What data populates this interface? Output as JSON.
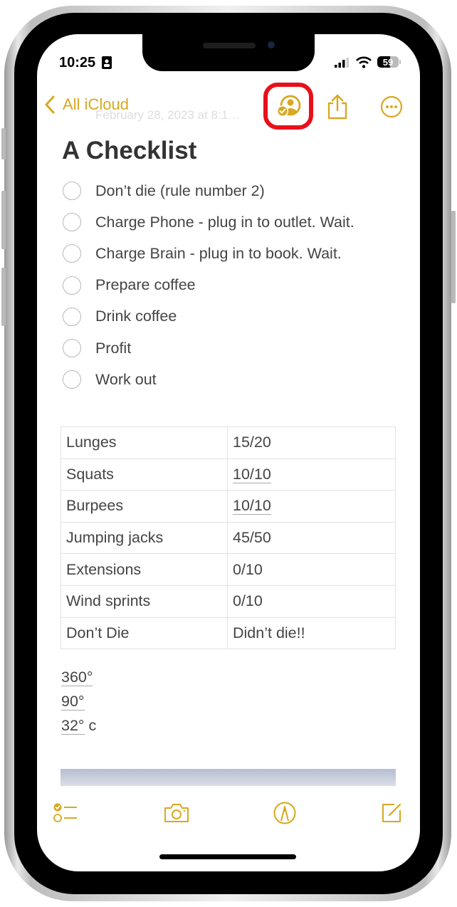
{
  "theme": {
    "accent": "#d8a820",
    "highlight": "#e8101a",
    "text": "#444444"
  },
  "status_bar": {
    "time": "10:25",
    "battery": "59"
  },
  "nav": {
    "back_label": "All iCloud",
    "date_text": "February 28, 2023 at 8:1…",
    "buttons": [
      "collaborate-icon",
      "share-icon",
      "more-icon"
    ]
  },
  "note": {
    "title": "A Checklist",
    "checklist": [
      {
        "text": "Don’t die (rule number 2)",
        "checked": false
      },
      {
        "text": "Charge Phone - plug in to outlet. Wait.",
        "checked": false
      },
      {
        "text": "Charge Brain - plug in to book. Wait.",
        "checked": false
      },
      {
        "text": "Prepare coffee",
        "checked": false
      },
      {
        "text": "Drink coffee",
        "checked": false
      },
      {
        "text": "Profit",
        "checked": false
      },
      {
        "text": "Work out",
        "checked": false
      }
    ],
    "table": [
      [
        "Lunges",
        "15/20"
      ],
      [
        "Squats",
        "10/10"
      ],
      [
        "Burpees",
        "10/10"
      ],
      [
        "Jumping jacks",
        "45/50"
      ],
      [
        "Extensions",
        "0/10"
      ],
      [
        "Wind sprints",
        "0/10"
      ],
      [
        "Don’t Die",
        "Didn’t die!!"
      ]
    ],
    "measurements": [
      {
        "value": "360°",
        "suffix": ""
      },
      {
        "value": "90°",
        "suffix": ""
      },
      {
        "value": "32°",
        "suffix": " c"
      }
    ]
  },
  "toolbar": [
    "checklist-icon",
    "camera-icon",
    "markup-icon",
    "compose-icon"
  ]
}
